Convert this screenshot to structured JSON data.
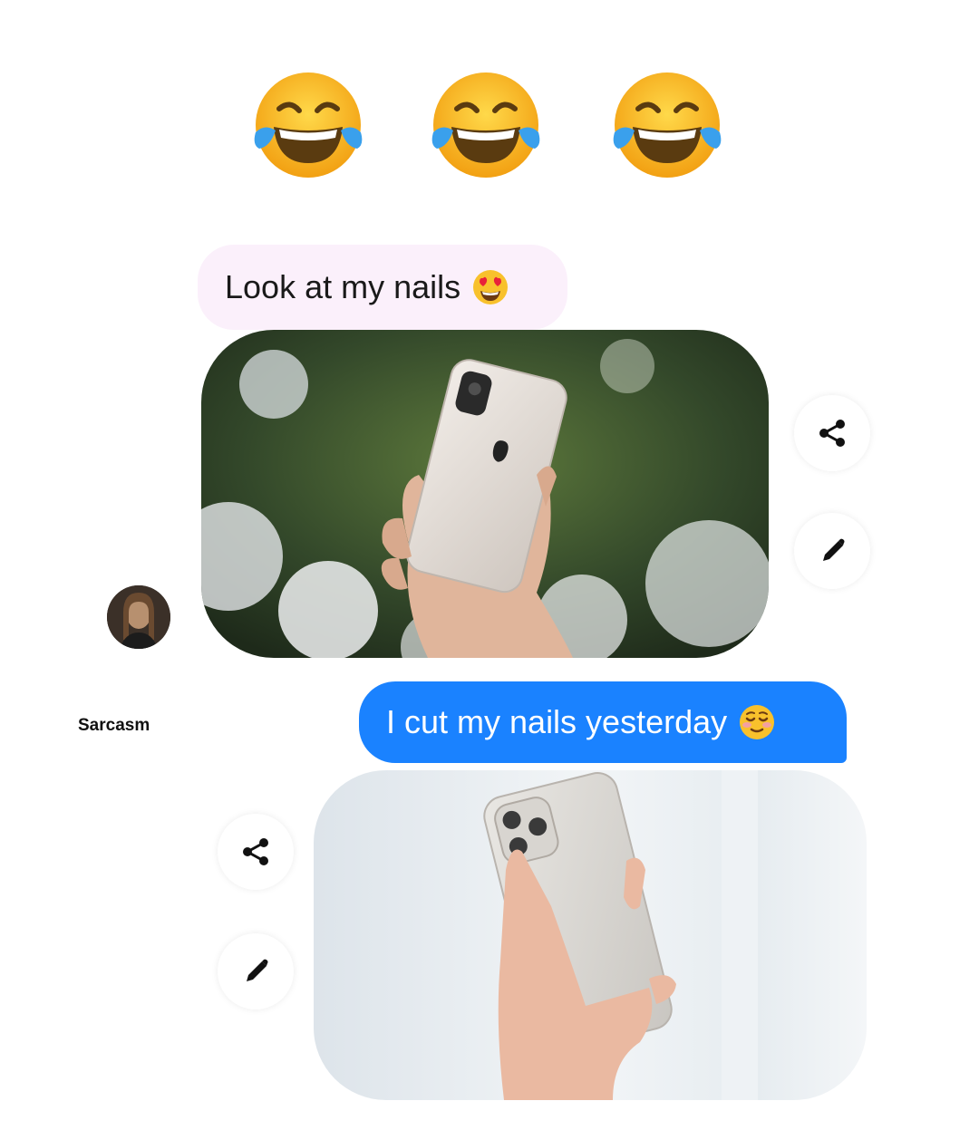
{
  "reaction": {
    "emoji_name": "face-with-tears-of-joy",
    "count": 3
  },
  "messages": [
    {
      "direction": "incoming",
      "text": "Look at my nails",
      "emoji_name": "heart-eyes-face"
    },
    {
      "direction": "outgoing",
      "text": "I cut my nails yesterday",
      "emoji_name": "relieved-face"
    }
  ],
  "attachments": [
    {
      "icon_name": "photo-hand-holding-phone-with-long-nails"
    },
    {
      "icon_name": "photo-hand-holding-phone-short-nails"
    }
  ],
  "actions": [
    {
      "share_icon": "share-icon",
      "edit_icon": "pencil-icon"
    },
    {
      "share_icon": "share-icon",
      "edit_icon": "pencil-icon"
    }
  ],
  "sender": {
    "avatar_icon": "avatar"
  },
  "watermark": {
    "text": "Sarcasm"
  },
  "colors": {
    "outgoing_bubble": "#1a82ff",
    "incoming_bubble": "#fbf0fb",
    "background": "#ffffff"
  }
}
